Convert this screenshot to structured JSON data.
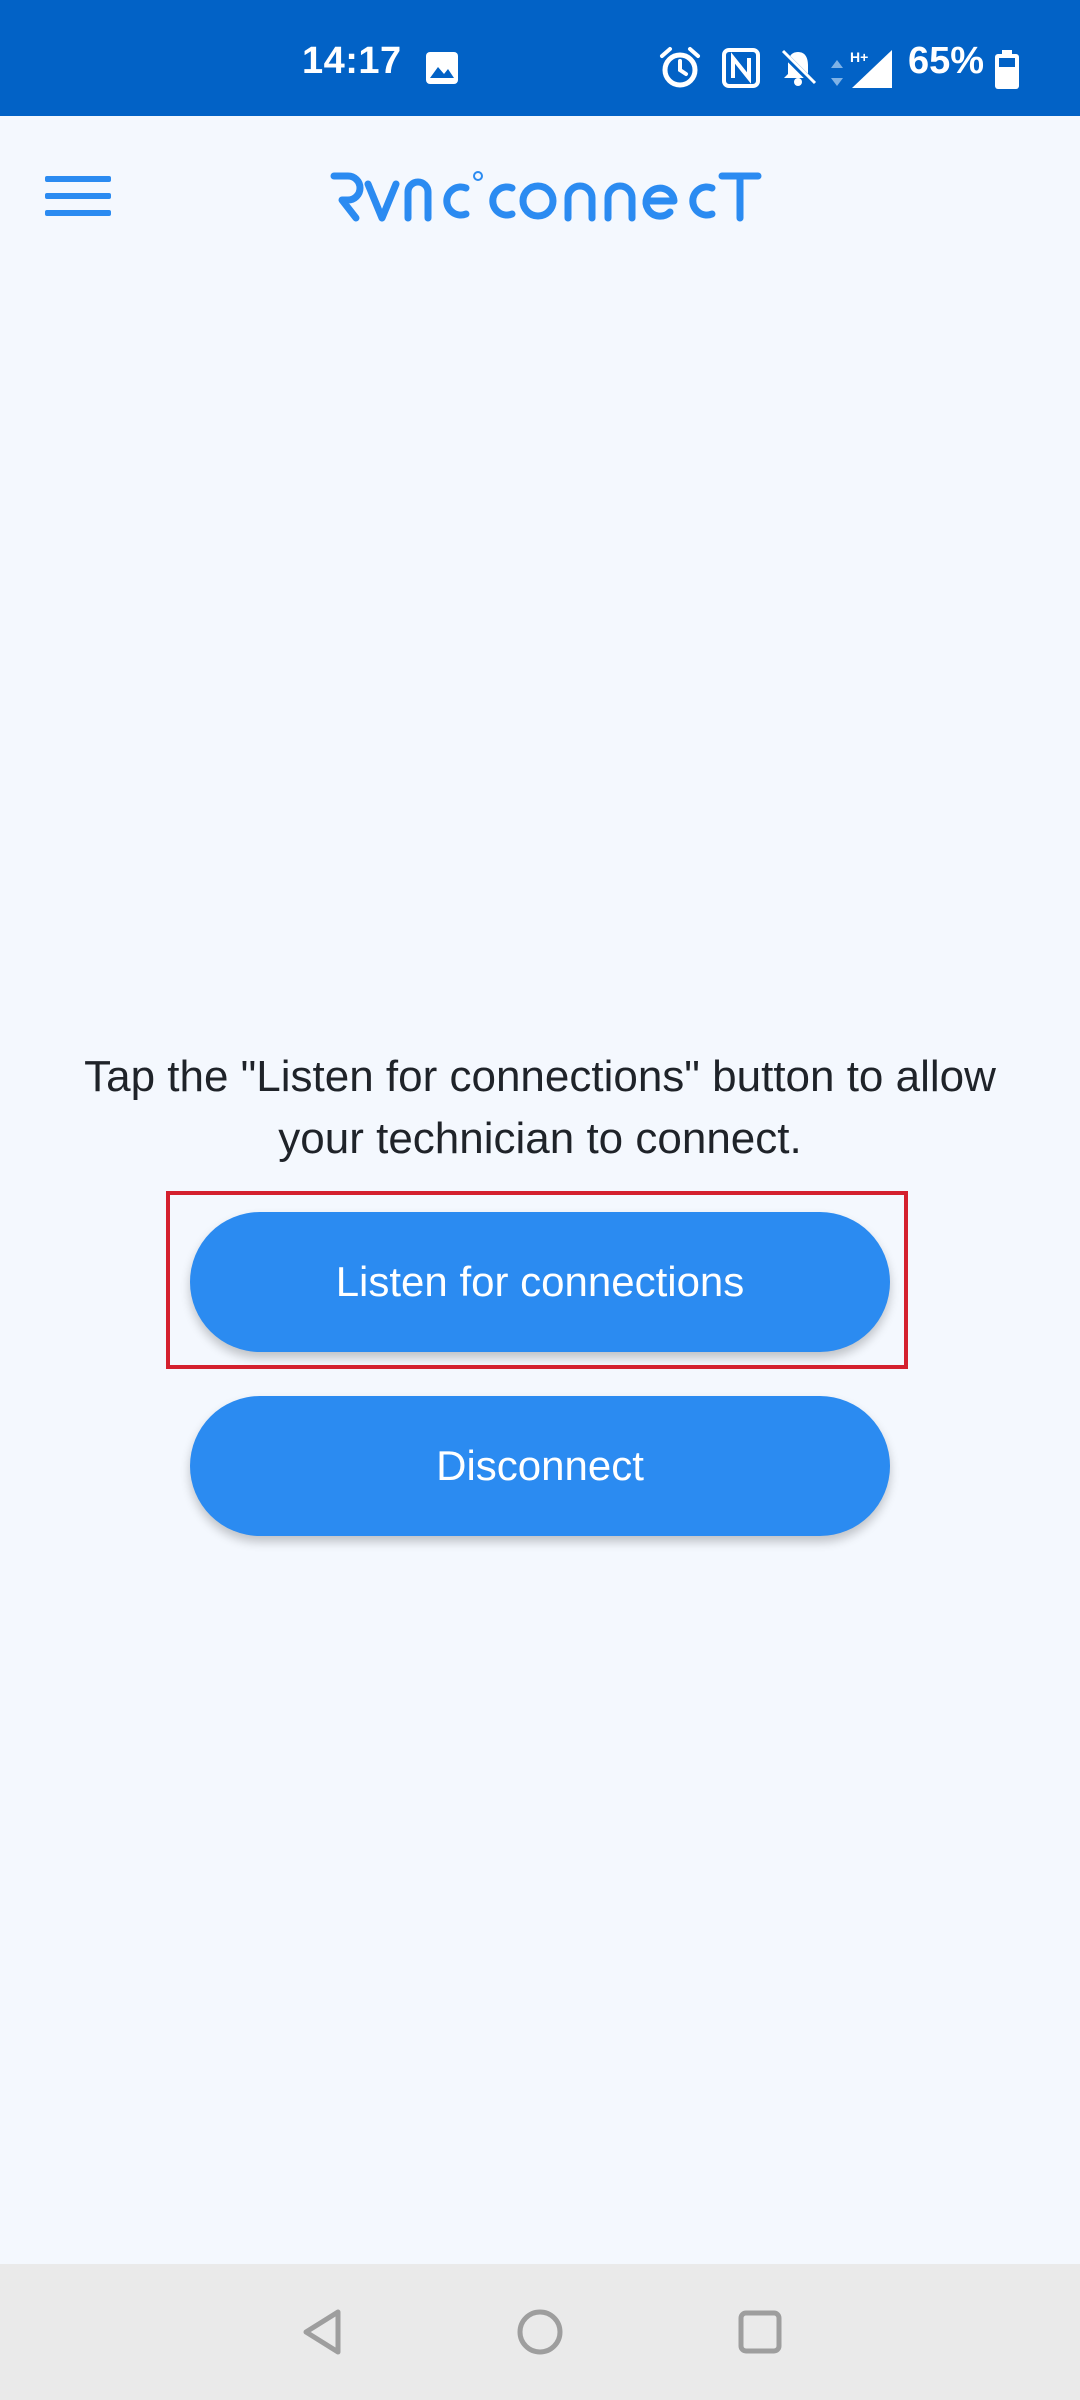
{
  "status_bar": {
    "time": "14:17",
    "battery_percent": "65%",
    "icons": [
      "image-icon",
      "alarm-icon",
      "nfc-icon",
      "notifications-off-icon",
      "data-arrows-icon",
      "signal-icon",
      "battery-icon"
    ],
    "network_label": "H+"
  },
  "app_bar": {
    "logo_text": "RVNC CONNECT",
    "logo_color": "#2b8bf1",
    "menu_icon": "hamburger-menu-icon"
  },
  "main": {
    "instruction": "Tap the \"Listen for connections\" button to allow your technician to connect.",
    "listen_button_label": "Listen for connections",
    "disconnect_button_label": "Disconnect"
  },
  "nav_bar": {
    "icons": [
      "back-icon",
      "home-icon",
      "recents-icon"
    ]
  },
  "colors": {
    "status_bar": "#0262c6",
    "background": "#f4f8fe",
    "button": "#2b8bf1",
    "highlight": "#d4202e"
  }
}
